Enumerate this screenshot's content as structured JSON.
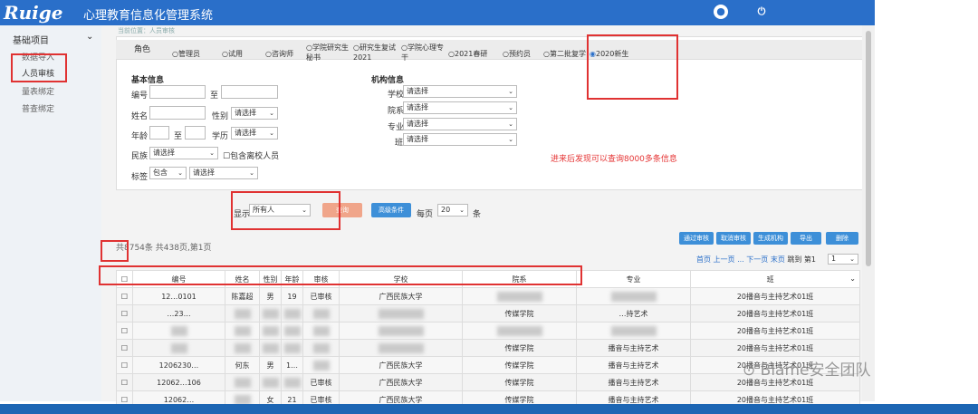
{
  "header": {
    "logo": "Ruige",
    "title": "心理教育信息化管理系统",
    "user_icon": "user-circle-icon",
    "power_icon": "power-icon"
  },
  "sidebar": {
    "heading": "基础项目",
    "items": [
      "数据导入",
      "人员审核",
      "量表绑定",
      "普查绑定"
    ]
  },
  "breadcrumb": "当前位置：人员审核",
  "roles": {
    "label": "角色",
    "options": [
      "管理员",
      "试用",
      "咨询师",
      "学院研究生秘书",
      "研究生复试2021",
      "学院心理专干",
      "2021春研",
      "预约员",
      "第二批复学",
      "2020新生"
    ],
    "selected": "2020新生"
  },
  "basic": {
    "title": "基本信息",
    "id_label": "编号",
    "to_label": "至",
    "name_label": "姓名",
    "gender_label": "性别",
    "gender_value": "请选择",
    "age_label": "年龄",
    "age_to": "至",
    "edu_label": "学历",
    "edu_value": "请选择",
    "nation_label": "民族",
    "nation_value": "请选择",
    "graduated_label": "包含离校人员",
    "tag_label": "标签",
    "tag_mode": "包含",
    "tag_value": "请选择"
  },
  "org": {
    "title": "机构信息",
    "school_label": "学校",
    "college_label": "院系",
    "major_label": "专业",
    "class_label": "班",
    "placeholder": "请选择"
  },
  "annotation": "进来后发现可以查询8000多条信息",
  "query": {
    "display_label": "显示",
    "display_value": "所有人",
    "search_btn": "查询",
    "advanced_btn": "高级条件",
    "per_page_label": "每页",
    "per_page_value": "20",
    "unit": "条"
  },
  "actions": [
    "通过审核",
    "取消审核",
    "生成机构",
    "导出",
    "删除"
  ],
  "summary": "共8754条 共438页,第1页",
  "pager": {
    "first": "首页",
    "prev": "上一页",
    "ellipsis": "...",
    "next": "下一页",
    "last": "末页",
    "jump": "跳到",
    "page": "第1",
    "page_sel": "1"
  },
  "table": {
    "headers": [
      "编号",
      "姓名",
      "性别",
      "年龄",
      "审核",
      "学校",
      "院系",
      "专业",
      "班"
    ],
    "rows": [
      [
        "12…0101",
        "陈嘉超",
        "男",
        "19",
        "已审核",
        "广西民族大学",
        "",
        "",
        "20播音与主持艺术01班"
      ],
      [
        "…23…",
        "",
        "",
        "",
        "",
        "",
        "传媒学院",
        "…持艺术",
        "20播音与主持艺术01班"
      ],
      [
        "",
        "",
        "",
        "",
        "",
        "",
        "",
        "",
        "20播音与主持艺术01班"
      ],
      [
        "",
        "",
        "",
        "",
        "",
        "",
        "传媒学院",
        "播音与主持艺术",
        "20播音与主持艺术01班"
      ],
      [
        "1206230…",
        "何东",
        "男",
        "1…",
        "",
        "广西民族大学",
        "传媒学院",
        "播音与主持艺术",
        "20播音与主持艺术01班"
      ],
      [
        "12062…106",
        "",
        "",
        "",
        "已审核",
        "广西民族大学",
        "传媒学院",
        "播音与主持艺术",
        "20播音与主持艺术01班"
      ],
      [
        "12062…",
        "",
        "女",
        "21",
        "已审核",
        "广西民族大学",
        "传媒学院",
        "播音与主持艺术",
        "20播音与主持艺术01班"
      ]
    ]
  },
  "watermark": "Blame安全团队",
  "colors": {
    "header": "#2a6fc9",
    "btn_blue": "#3d8fd8",
    "btn_orange": "#f0a58a",
    "red_box": "#e03232"
  }
}
